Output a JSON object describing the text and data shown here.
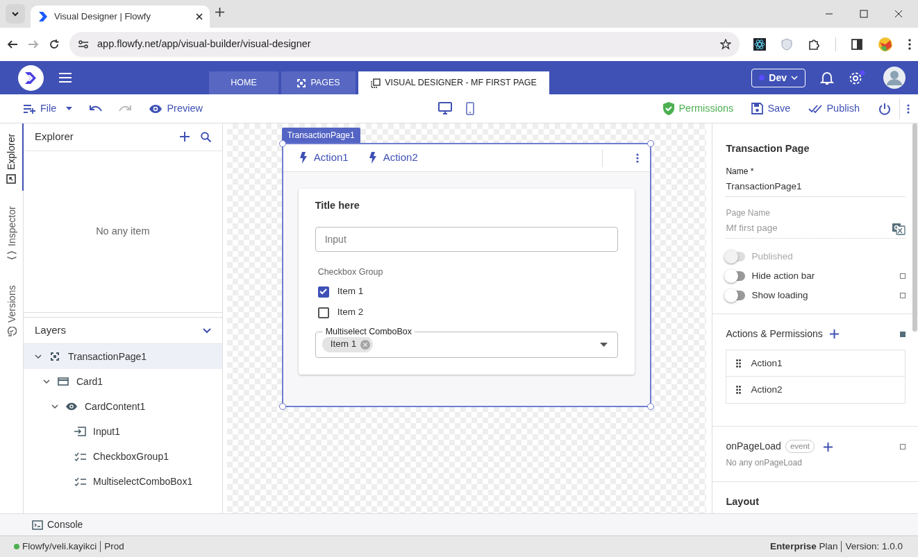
{
  "browser": {
    "tab_title": "Visual Designer | Flowfy",
    "url": "app.flowfy.net/app/visual-builder/visual-designer"
  },
  "header": {
    "tabs": [
      {
        "label": "HOME",
        "selected": false,
        "kind": "plain"
      },
      {
        "label": "PAGES",
        "selected": false,
        "kind": "pages"
      },
      {
        "label": "VISUAL DESIGNER - MF FIRST PAGE",
        "selected": true,
        "kind": "designer"
      }
    ],
    "environment": "Dev"
  },
  "toolbar": {
    "file": "File",
    "preview": "Preview",
    "devices": [
      {
        "kind": "desktop",
        "selected": true
      },
      {
        "kind": "mobile",
        "selected": false
      }
    ],
    "permissions": "Permissions",
    "save": "Save",
    "publish": "Publish"
  },
  "side_tabs": [
    {
      "label": "Explorer",
      "selected": true,
      "kind": "explorer"
    },
    {
      "label": "Inspector",
      "selected": false,
      "kind": "inspector"
    },
    {
      "label": "Versions",
      "selected": false,
      "kind": "versions"
    }
  ],
  "explorer": {
    "title": "Explorer",
    "empty_text": "No any item"
  },
  "layers": {
    "title": "Layers",
    "tree": [
      {
        "label": "TransactionPage1",
        "kind": "page",
        "selected": true,
        "expanded": true,
        "children": [
          {
            "label": "Card1",
            "kind": "card",
            "selected": false,
            "expanded": true,
            "children": [
              {
                "label": "CardContent1",
                "kind": "content",
                "selected": false,
                "expanded": true,
                "children": [
                  {
                    "label": "Input1",
                    "kind": "input",
                    "selected": false
                  },
                  {
                    "label": "CheckboxGroup1",
                    "kind": "checklist",
                    "selected": false
                  },
                  {
                    "label": "MultiselectComboBox1",
                    "kind": "checklist",
                    "selected": false
                  }
                ]
              }
            ]
          }
        ]
      }
    ]
  },
  "canvas": {
    "page_tag": "TransactionPage1",
    "actions": [
      "Action1",
      "Action2"
    ],
    "card": {
      "title": "Title here",
      "input_placeholder": "Input",
      "checkbox_group": {
        "label": "Checkbox Group",
        "items": [
          {
            "label": "Item 1",
            "checked": true
          },
          {
            "label": "Item 2",
            "checked": false
          }
        ]
      },
      "combobox": {
        "label": "Multiselect ComboBox",
        "chips": [
          "Item 1"
        ]
      }
    }
  },
  "properties": {
    "title": "Transaction Page",
    "name_label": "Name *",
    "name_value": "TransactionPage1",
    "page_name_label": "Page Name",
    "page_name_value": "Mf first page",
    "toggles": [
      {
        "label": "Published",
        "on": false,
        "disabled": true
      },
      {
        "label": "Hide action bar",
        "on": false,
        "disabled": false
      },
      {
        "label": "Show loading",
        "on": false,
        "disabled": false
      }
    ],
    "actions_title": "Actions & Permissions",
    "actions": [
      "Action1",
      "Action2"
    ],
    "event": {
      "name": "onPageLoad",
      "badge": "event",
      "empty_text": "No any onPageLoad"
    },
    "layout_title": "Layout"
  },
  "console": "Console",
  "status": {
    "user": "Flowfy/veli.kayikci",
    "env": "Prod",
    "plan": "**Enterprise** Plan",
    "version": "Version: 1.0.0"
  }
}
